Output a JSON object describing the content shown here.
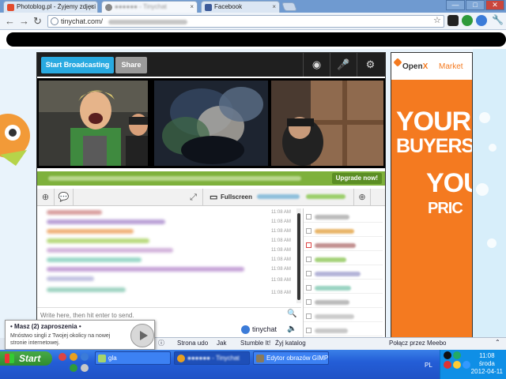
{
  "browser": {
    "tabs": [
      {
        "label": "Photoblog.pl - Żyjemy zdjęci",
        "favicon_color": "#e34b2c"
      },
      {
        "label": "●●●●●● - Tinychat",
        "favicon_color": "#888888"
      },
      {
        "label": "Facebook",
        "favicon_color": "#3b5998"
      }
    ],
    "window_buttons": [
      "—",
      "□",
      "✕"
    ],
    "url_text": "tinychat.com/"
  },
  "tinychat": {
    "start_broadcasting": "Start Broadcasting",
    "share": "Share",
    "upgrade": "Upgrade now!",
    "fullscreen": "Fullscreen",
    "input_placeholder": "Write here, then hit enter to send.",
    "brand": "tinychat",
    "timestamps": [
      "11:08 AM",
      "11:08 AM",
      "11:08 AM",
      "11:08 AM",
      "11:08 AM",
      "11:08 AM",
      "11:08 AM",
      "11:08 AM",
      "11:08 AM"
    ]
  },
  "ad": {
    "brand_open": "Open",
    "brand_x": "X",
    "market": "Market",
    "line1": "YOUR",
    "line2": "BUYERS",
    "line3": "YOU",
    "line4": "PRIC"
  },
  "meebo": {
    "items": [
      "Strona udo",
      "Jak",
      "Stumble It!",
      "Żyj katalog",
      "Połącz przez Meebo"
    ]
  },
  "notification": {
    "title": "• Masz (2) zaproszenia •",
    "body": "Mnóstwo singli z Twojej okolicy na nowej stronie internetowej."
  },
  "taskbar": {
    "start": "Start",
    "tasks": [
      "gla",
      "●●●●●● - Tinychat",
      "Edytor obrazów GIMP"
    ],
    "lang": "PL",
    "time": "11:08",
    "day": "środa",
    "date": "2012-04-11"
  }
}
